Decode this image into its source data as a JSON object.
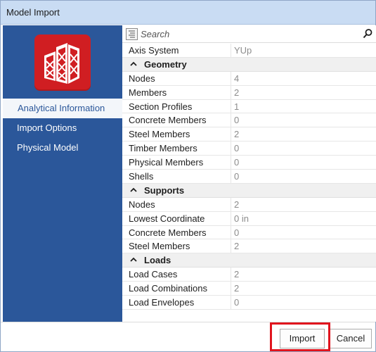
{
  "window": {
    "title": "Model Import"
  },
  "sidebar": {
    "items": [
      {
        "label": "Analytical Information",
        "active": true
      },
      {
        "label": "Import Options",
        "active": false
      },
      {
        "label": "Physical Model",
        "active": false
      }
    ]
  },
  "search": {
    "placeholder": "Search"
  },
  "properties": {
    "axis": {
      "label": "Axis System",
      "value": "YUp"
    },
    "geometry": {
      "title": "Geometry",
      "rows": [
        {
          "label": "Nodes",
          "value": "4"
        },
        {
          "label": "Members",
          "value": "2"
        },
        {
          "label": "Section Profiles",
          "value": "1"
        },
        {
          "label": "Concrete Members",
          "value": "0"
        },
        {
          "label": "Steel Members",
          "value": "2"
        },
        {
          "label": "Timber Members",
          "value": "0"
        },
        {
          "label": "Physical Members",
          "value": "0"
        },
        {
          "label": "Shells",
          "value": "0"
        }
      ]
    },
    "supports": {
      "title": "Supports",
      "rows": [
        {
          "label": "Nodes",
          "value": "2"
        },
        {
          "label": "Lowest Coordinate",
          "value": "0 in"
        },
        {
          "label": "Concrete Members",
          "value": "0"
        },
        {
          "label": "Steel Members",
          "value": "2"
        }
      ]
    },
    "loads": {
      "title": "Loads",
      "rows": [
        {
          "label": "Load Cases",
          "value": "2"
        },
        {
          "label": "Load Combinations",
          "value": "2"
        },
        {
          "label": "Load Envelopes",
          "value": "0"
        }
      ]
    }
  },
  "footer": {
    "import_label": "Import",
    "cancel_label": "Cancel"
  },
  "colors": {
    "sidebar": "#2b579a",
    "titlebar": "#c9dcf3",
    "logo": "#d01e22",
    "highlight": "#e0141e"
  }
}
